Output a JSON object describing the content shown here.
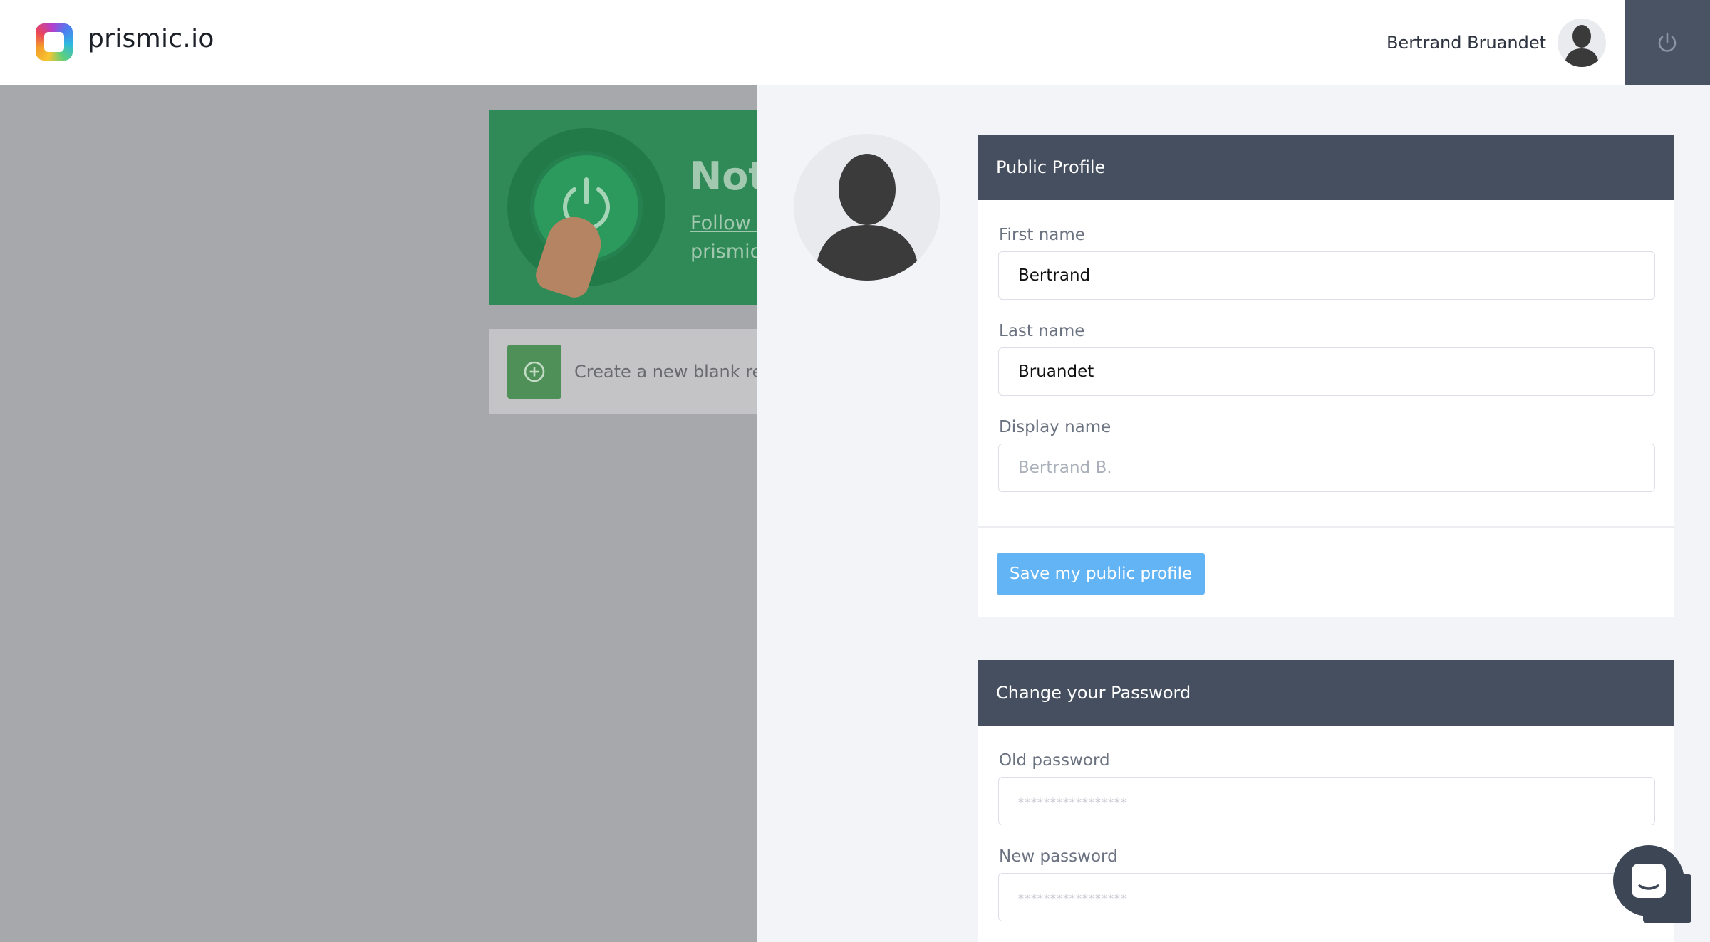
{
  "header": {
    "logo_text": "prismic.io",
    "user_name": "Bertrand Bruandet"
  },
  "background": {
    "promo_title": "Not",
    "promo_link": "Follow o",
    "promo_sub": "prismic.",
    "create_repo_label": "Create a new blank repo"
  },
  "public_profile": {
    "title": "Public Profile",
    "first_name_label": "First name",
    "first_name_value": "Bertrand",
    "last_name_label": "Last name",
    "last_name_value": "Bruandet",
    "display_name_label": "Display name",
    "display_name_placeholder": "Bertrand B.",
    "save_button": "Save my public profile"
  },
  "change_password": {
    "title": "Change your Password",
    "old_password_label": "Old password",
    "old_password_placeholder": "*****************",
    "new_password_label": "New password",
    "new_password_placeholder": "*****************"
  },
  "icons": {
    "logout": "power-icon",
    "chat": "chat-bubble-icon",
    "add": "plus-circle-icon"
  },
  "colors": {
    "header_bg": "#ffffff",
    "logout_bg": "#4a5363",
    "panel_header_bg": "#464f5f",
    "save_button_bg": "#63b4f5",
    "overlay_bg": "#a7a8ab",
    "drawer_bg": "#f2f4f8"
  }
}
